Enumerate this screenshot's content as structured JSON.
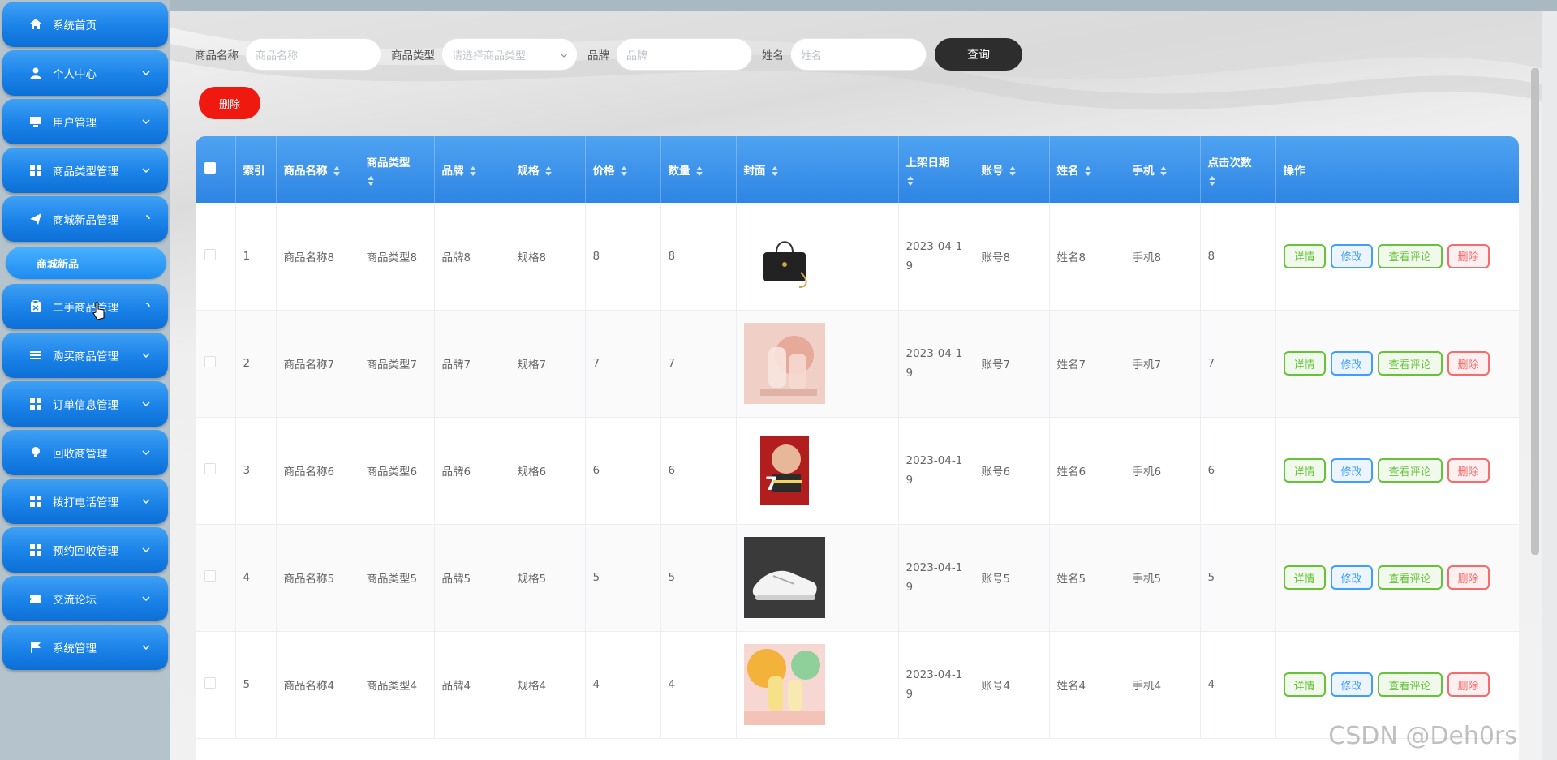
{
  "sidebar": {
    "items": [
      {
        "label": "系统首页",
        "icon": "home-icon",
        "has_arrow": false
      },
      {
        "label": "个人中心",
        "icon": "user-icon",
        "has_arrow": true
      },
      {
        "label": "用户管理",
        "icon": "monitor-icon",
        "has_arrow": true
      },
      {
        "label": "商品类型管理",
        "icon": "grid-icon",
        "has_arrow": true
      },
      {
        "label": "商城新品管理",
        "icon": "send-icon",
        "has_arrow": true,
        "expanded": true
      },
      {
        "label": "二手商品管理",
        "icon": "clipboard-icon",
        "has_arrow": true
      },
      {
        "label": "购买商品管理",
        "icon": "list-icon",
        "has_arrow": true
      },
      {
        "label": "订单信息管理",
        "icon": "grid-icon",
        "has_arrow": true
      },
      {
        "label": "回收商管理",
        "icon": "bulb-icon",
        "has_arrow": true
      },
      {
        "label": "拨打电话管理",
        "icon": "grid-icon",
        "has_arrow": true
      },
      {
        "label": "预约回收管理",
        "icon": "grid-icon",
        "has_arrow": true
      },
      {
        "label": "交流论坛",
        "icon": "ticket-icon",
        "has_arrow": true
      },
      {
        "label": "系统管理",
        "icon": "flag-icon",
        "has_arrow": true
      }
    ],
    "submenu": {
      "label": "商城新品"
    }
  },
  "search": {
    "name_label": "商品名称",
    "name_placeholder": "商品名称",
    "type_label": "商品类型",
    "type_placeholder": "请选择商品类型",
    "brand_label": "品牌",
    "brand_placeholder": "品牌",
    "person_label": "姓名",
    "person_placeholder": "姓名",
    "query_button": "查询"
  },
  "actions": {
    "delete_button": "删除"
  },
  "table": {
    "headers": [
      "索引",
      "商品名称",
      "商品类型",
      "品牌",
      "规格",
      "价格",
      "数量",
      "封面",
      "上架日期",
      "账号",
      "姓名",
      "手机",
      "点击次数",
      "操作"
    ],
    "row_buttons": {
      "detail": "详情",
      "edit": "修改",
      "review": "查看评论",
      "delete": "删除"
    },
    "rows": [
      {
        "index": "1",
        "name": "商品名称8",
        "type": "商品类型8",
        "brand": "品牌8",
        "spec": "规格8",
        "price": "8",
        "qty": "8",
        "cover": "black-handbag",
        "date": "2023-04-1\n9",
        "account": "账号8",
        "person": "姓名8",
        "phone": "手机8",
        "clicks": "8"
      },
      {
        "index": "2",
        "name": "商品名称7",
        "type": "商品类型7",
        "brand": "品牌7",
        "spec": "规格7",
        "price": "7",
        "qty": "7",
        "cover": "pink-bottles",
        "date": "2023-04-1\n9",
        "account": "账号7",
        "person": "姓名7",
        "phone": "手机7",
        "clicks": "7"
      },
      {
        "index": "3",
        "name": "商品名称6",
        "type": "商品类型6",
        "brand": "品牌6",
        "spec": "规格6",
        "price": "6",
        "qty": "6",
        "cover": "red-book",
        "date": "2023-04-1\n9",
        "account": "账号6",
        "person": "姓名6",
        "phone": "手机6",
        "clicks": "6"
      },
      {
        "index": "4",
        "name": "商品名称5",
        "type": "商品类型5",
        "brand": "品牌5",
        "spec": "规格5",
        "price": "5",
        "qty": "5",
        "cover": "white-sneaker",
        "date": "2023-04-1\n9",
        "account": "账号5",
        "person": "姓名5",
        "phone": "手机5",
        "clicks": "5"
      },
      {
        "index": "5",
        "name": "商品名称4",
        "type": "商品类型4",
        "brand": "品牌4",
        "spec": "规格4",
        "price": "4",
        "qty": "4",
        "cover": "baby-bottles",
        "date": "2023-04-1\n9",
        "account": "账号4",
        "person": "姓名4",
        "phone": "手机4",
        "clicks": "4"
      }
    ]
  },
  "watermark": "CSDN @Deh0rs",
  "colors": {
    "primary": "#1a82e8",
    "header": "#3a8ee6",
    "danger": "#f0190f",
    "query": "#2d2d2d"
  }
}
